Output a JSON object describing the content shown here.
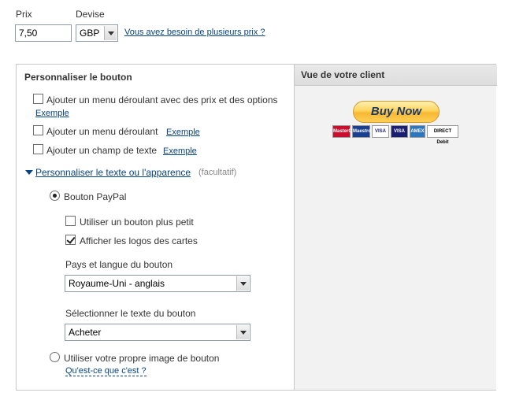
{
  "price": {
    "label": "Prix",
    "value": "7,50"
  },
  "currency": {
    "label": "Devise",
    "value": "GBP",
    "multiple_prices_link": "Vous avez besoin de plusieurs prix ?"
  },
  "customize": {
    "title": "Personnaliser le bouton",
    "options": [
      {
        "label": "Ajouter un menu déroulant avec des prix et des options",
        "example": "Exemple",
        "checked": false
      },
      {
        "label": "Ajouter un menu déroulant",
        "example": "Exemple",
        "checked": false
      },
      {
        "label": "Ajouter un champ de texte",
        "example": "Exemple",
        "checked": false
      }
    ],
    "appearance_link": "Personnaliser le texte ou l'apparence",
    "optional_note": "(facultatif)",
    "paypal_button_label": "Bouton PayPal",
    "smaller_button_label": "Utiliser un bouton plus petit",
    "show_card_logos_label": "Afficher les logos des cartes",
    "country_language_label": "Pays et langue du bouton",
    "country_language_value": "Royaume-Uni - anglais",
    "button_text_label": "Sélectionner le texte du bouton",
    "button_text_value": "Acheter",
    "own_image_label": "Utiliser votre propre image de bouton",
    "whats_this_link": "Qu'est-ce que c'est ?"
  },
  "preview": {
    "title": "Vue de votre client",
    "button_text": "Buy Now",
    "cards": [
      "MasterCard",
      "Maestro",
      "VISA",
      "VISA",
      "AMEX",
      "DIRECT Debit"
    ]
  },
  "colors": {
    "link": "#084482",
    "button_gold": "#ffc439",
    "panel_border": "#c8c8c8"
  }
}
